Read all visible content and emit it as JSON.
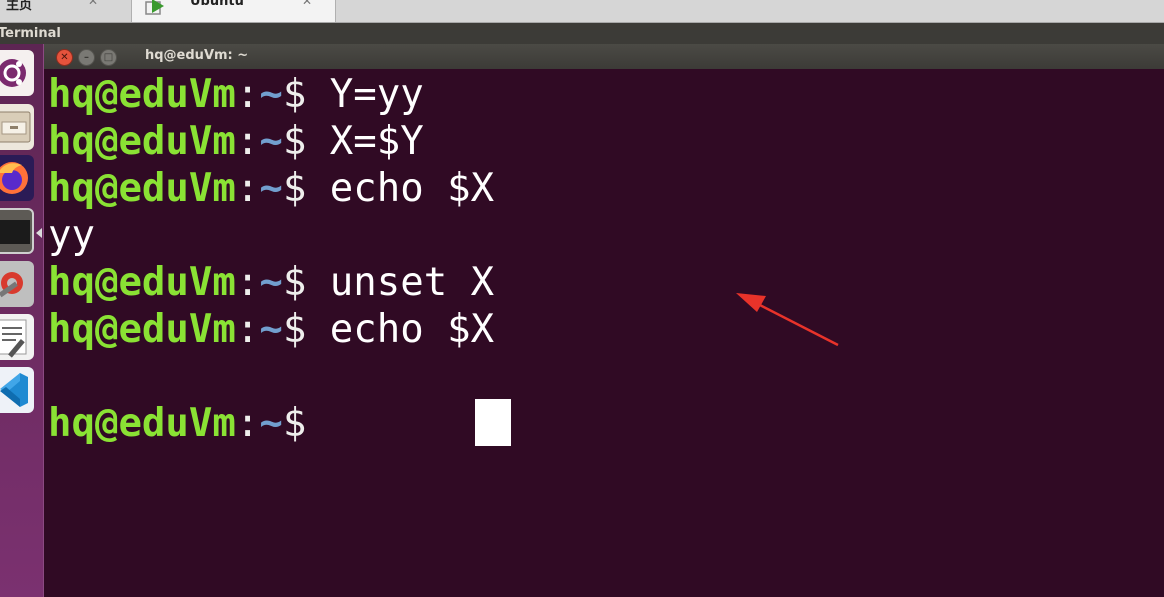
{
  "vm_tabs": [
    {
      "label": "主页",
      "close": "✕"
    },
    {
      "label": "Ubuntu",
      "close": "✕"
    }
  ],
  "app_title": "Terminal",
  "launcher": [
    {
      "name": "ubuntu-icon"
    },
    {
      "name": "files-icon"
    },
    {
      "name": "firefox-icon"
    },
    {
      "name": "terminal-icon"
    },
    {
      "name": "settings-icon"
    },
    {
      "name": "text-editor-icon"
    },
    {
      "name": "vscode-icon"
    }
  ],
  "window": {
    "title": "hq@eduVm: ~",
    "close": "✕",
    "minimize": "–",
    "maximize": "□"
  },
  "prompt": {
    "user_host": "hq@eduVm",
    "sep": ":",
    "path": "~",
    "dollar": "$ "
  },
  "lines": [
    {
      "type": "cmd",
      "text": "Y=yy"
    },
    {
      "type": "cmd",
      "text": "X=$Y"
    },
    {
      "type": "cmd",
      "text": "echo $X"
    },
    {
      "type": "output",
      "text": "yy"
    },
    {
      "type": "cmd",
      "text": "unset X"
    },
    {
      "type": "cmd",
      "text": "echo $X"
    },
    {
      "type": "output",
      "text": ""
    },
    {
      "type": "cmd",
      "text": ""
    }
  ],
  "colors": {
    "background": "#300a24",
    "prompt_user": "#8ae234",
    "prompt_path": "#729fcf",
    "text": "#ffffff",
    "annotation_arrow": "#e8332a"
  }
}
